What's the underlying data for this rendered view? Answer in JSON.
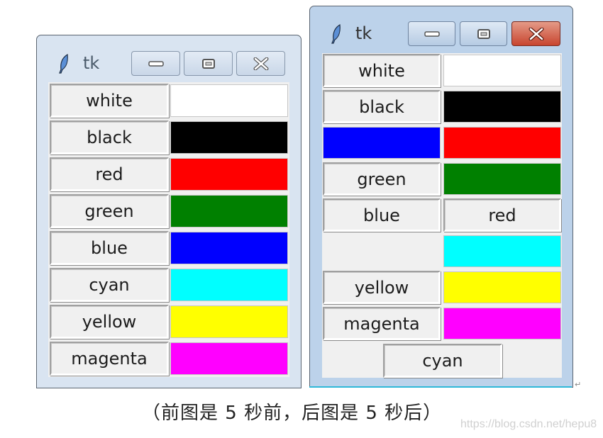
{
  "before_window": {
    "title": "tk",
    "icon": "feather-icon",
    "controls": [
      "minimize-icon",
      "maximize-icon",
      "close-icon"
    ],
    "state": "inactive",
    "rows": [
      {
        "label": "white",
        "swatch": "#ffffff"
      },
      {
        "label": "black",
        "swatch": "#000000"
      },
      {
        "label": "red",
        "swatch": "#ff0000"
      },
      {
        "label": "green",
        "swatch": "#008000"
      },
      {
        "label": "blue",
        "swatch": "#0000ff"
      },
      {
        "label": "cyan",
        "swatch": "#00ffff"
      },
      {
        "label": "yellow",
        "swatch": "#ffff00"
      },
      {
        "label": "magenta",
        "swatch": "#ff00ff"
      }
    ]
  },
  "after_window": {
    "title": "tk",
    "icon": "feather-icon",
    "controls": [
      "minimize-icon",
      "maximize-icon",
      "close-icon"
    ],
    "state": "active",
    "rows": [
      {
        "left": {
          "type": "button",
          "label": "white"
        },
        "right": {
          "type": "swatch",
          "color": "#ffffff"
        }
      },
      {
        "left": {
          "type": "button",
          "label": "black"
        },
        "right": {
          "type": "swatch",
          "color": "#000000"
        }
      },
      {
        "left": {
          "type": "swatch",
          "color": "#0000ff"
        },
        "right": {
          "type": "swatch",
          "color": "#ff0000"
        }
      },
      {
        "left": {
          "type": "button",
          "label": "green"
        },
        "right": {
          "type": "swatch",
          "color": "#008000"
        }
      },
      {
        "left": {
          "type": "button",
          "label": "blue"
        },
        "right": {
          "type": "button",
          "label": "red"
        }
      },
      {
        "left": {
          "type": "empty"
        },
        "right": {
          "type": "swatch",
          "color": "#00ffff"
        }
      },
      {
        "left": {
          "type": "button",
          "label": "yellow"
        },
        "right": {
          "type": "swatch",
          "color": "#ffff00"
        }
      },
      {
        "left": {
          "type": "button",
          "label": "magenta"
        },
        "right": {
          "type": "swatch",
          "color": "#ff00ff"
        }
      }
    ],
    "bottom_button": {
      "label": "cyan"
    }
  },
  "caption": "（前图是 5 秒前，后图是 5 秒后）",
  "paragraph_mark": "↵",
  "watermark": "https://blog.csdn.net/hepu8"
}
